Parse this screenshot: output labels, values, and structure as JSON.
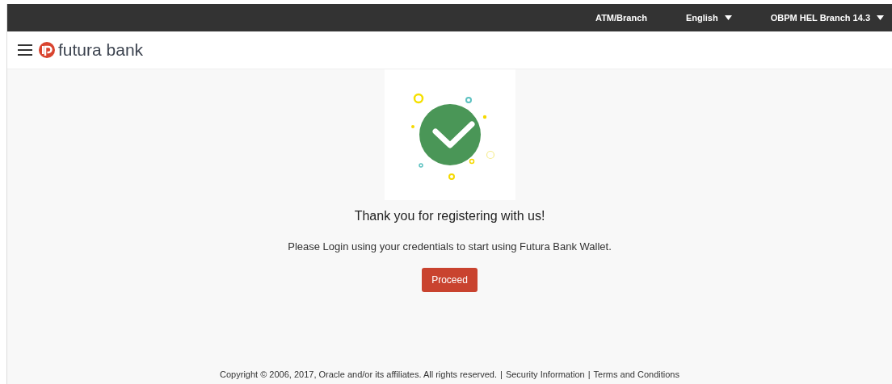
{
  "top_bar": {
    "links": [
      {
        "label": "ATM/Branch",
        "dropdown": false
      },
      {
        "label": "English",
        "dropdown": true
      },
      {
        "label": "OBPM HEL Branch 14.3",
        "dropdown": true
      }
    ]
  },
  "header": {
    "brand": "futura bank"
  },
  "message": {
    "title": "Thank you for registering with us!",
    "text": "Please Login using your credentials to start using Futura Bank Wallet.",
    "button": "Proceed"
  },
  "footer": {
    "copyright": "Copyright © 2006, 2017, Oracle and/or its affiliates. All rights reserved.",
    "links": [
      "Security Information",
      "Terms and Conditions"
    ],
    "separator": "|"
  }
}
